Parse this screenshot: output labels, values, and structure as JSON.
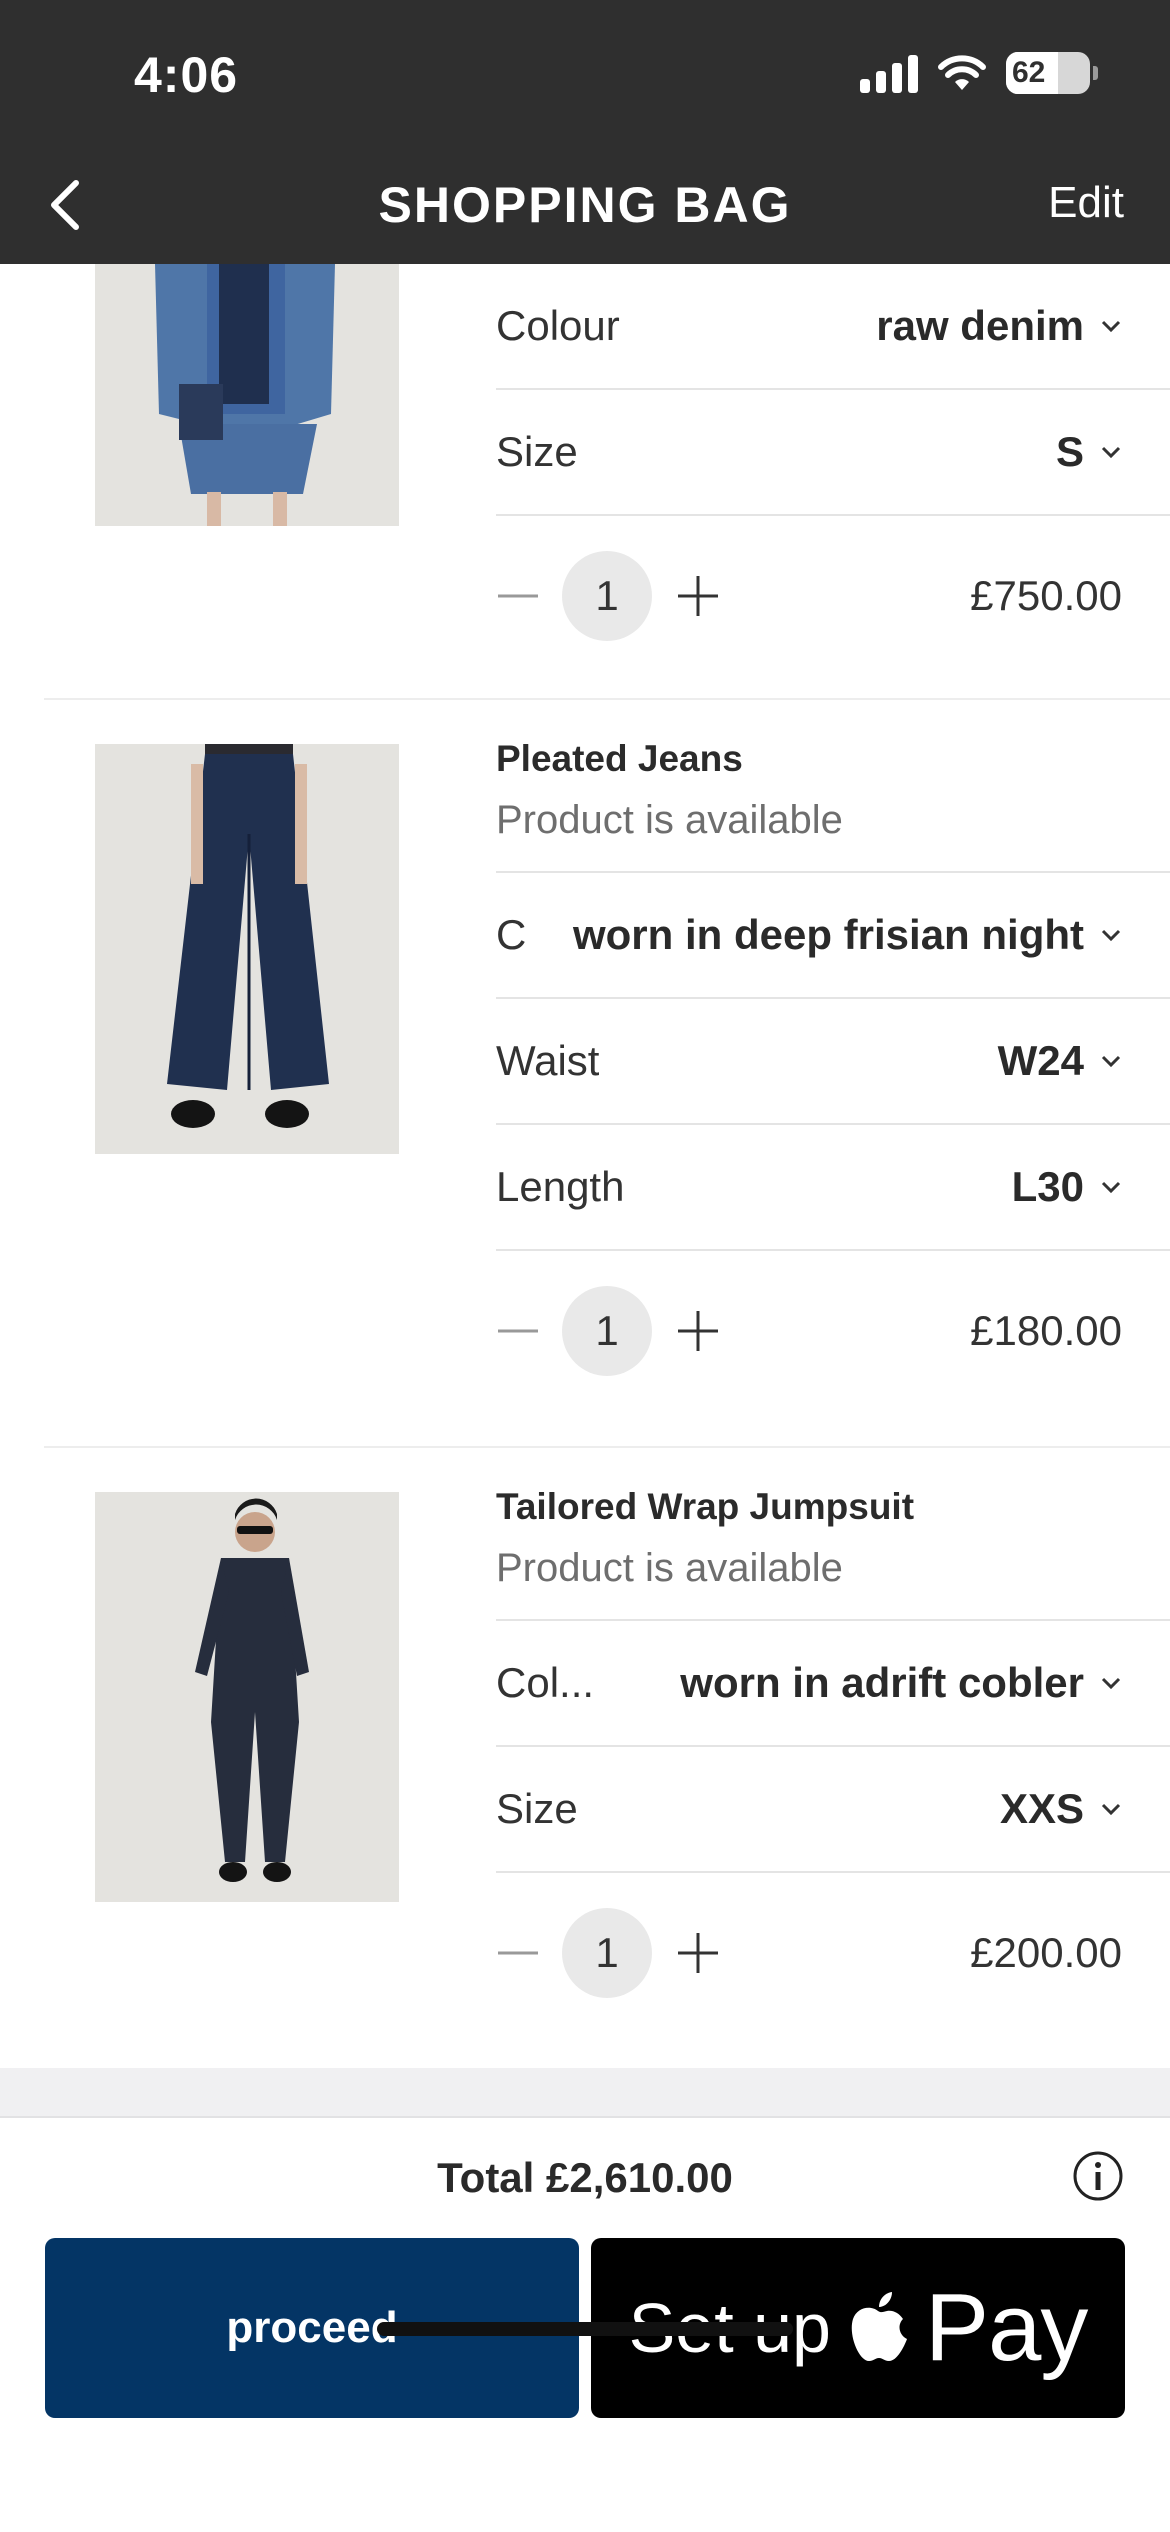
{
  "status_bar": {
    "time": "4:06",
    "battery": "62"
  },
  "nav": {
    "title": "SHOPPING BAG",
    "edit_label": "Edit"
  },
  "items": [
    {
      "name": "",
      "availability": "",
      "rows": [
        {
          "label": "Colour",
          "value": "raw denim"
        },
        {
          "label": "Size",
          "value": "S"
        }
      ],
      "quantity": "1",
      "price": "£750.00"
    },
    {
      "name": "Pleated Jeans",
      "availability": "Product is available",
      "rows": [
        {
          "label": "C",
          "value": "worn in deep frisian night"
        },
        {
          "label": "Waist",
          "value": "W24"
        },
        {
          "label": "Length",
          "value": "L30"
        }
      ],
      "quantity": "1",
      "price": "£180.00"
    },
    {
      "name": "Tailored Wrap Jumpsuit",
      "availability": "Product is available",
      "rows": [
        {
          "label": "Col...",
          "value": "worn in adrift cobler"
        },
        {
          "label": "Size",
          "value": "XXS"
        }
      ],
      "quantity": "1",
      "price": "£200.00"
    }
  ],
  "footer": {
    "total": "Total £2,610.00",
    "proceed_label": "proceed",
    "applepay_setup": "Set up",
    "applepay_pay": "Pay"
  },
  "colors": {
    "header_bg": "#2f2f2f",
    "proceed_bg": "#043565",
    "applepay_bg": "#000000"
  }
}
